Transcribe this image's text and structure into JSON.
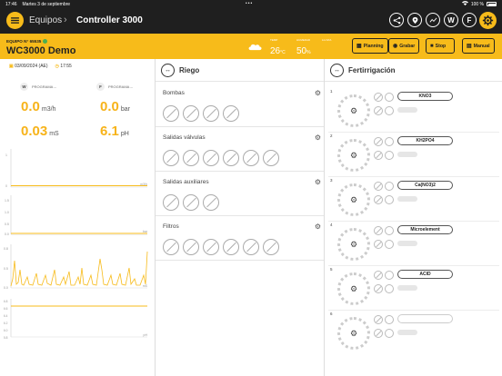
{
  "status_bar": {
    "time": "17:46",
    "date": "Martes 3 de septiembre",
    "dots": "•••",
    "battery": "100 %"
  },
  "nav": {
    "back_label": "Equipos",
    "title": "Controller 3000",
    "icon_w": "W",
    "icon_f": "F"
  },
  "header": {
    "equipo_label": "EQUIPO N° 65535",
    "name": "WC3000 Demo",
    "temp_label": "TEMP",
    "temp_value": "26",
    "temp_unit": "°C",
    "hum_label": "HUMEDAD",
    "hum_value": "50",
    "hum_unit": "%",
    "rain_label": "LLUVIA",
    "buttons": {
      "planning": "Planning",
      "grabar": "Grabar",
      "stop": "Stop",
      "manual": "Manual"
    }
  },
  "left": {
    "date": "03/09/2024 (AE)",
    "time": "17:55",
    "w_badge": "W",
    "w_prog": "PROGRAMA --",
    "f_badge": "F",
    "f_prog": "PROGRAMA --",
    "v1": "0.0",
    "u1": "m3/h",
    "v2": "0.0",
    "u2": "bar",
    "v3": "0.03",
    "u3": "mS",
    "v4": "6.1",
    "u4": "pH",
    "chart1": {
      "unit": "m3/h",
      "yticks": [
        "1",
        "0"
      ]
    },
    "chart2": {
      "unit": "bar",
      "yticks": [
        "1.5",
        "1.0",
        "0.5",
        "0.0"
      ]
    },
    "chart3": {
      "unit": "mS",
      "yticks": [
        "0.8",
        "0.5",
        "0.0"
      ]
    },
    "chart4": {
      "unit": "pH",
      "yticks": [
        "6.8",
        "6.6",
        "6.4",
        "6.2",
        "6.0",
        "5.8"
      ]
    }
  },
  "riego": {
    "title": "Riego",
    "groups": [
      {
        "title": "Bombas",
        "count": 4
      },
      {
        "title": "Salidas válvulas",
        "count": 6
      },
      {
        "title": "Salidas auxiliares",
        "count": 3
      },
      {
        "title": "Filtros",
        "count": 6
      }
    ]
  },
  "fert": {
    "title": "Fertirrigación",
    "rows": [
      {
        "num": "1",
        "chem": "KNO3"
      },
      {
        "num": "2",
        "chem": "KH2PO4"
      },
      {
        "num": "3",
        "chem": "Ca(NO3)2"
      },
      {
        "num": "4",
        "chem": "Microelement"
      },
      {
        "num": "5",
        "chem": "ACID"
      },
      {
        "num": "6",
        "chem": ""
      }
    ]
  },
  "colors": {
    "accent": "#f7bb1a",
    "dark": "#1f1f1f"
  }
}
